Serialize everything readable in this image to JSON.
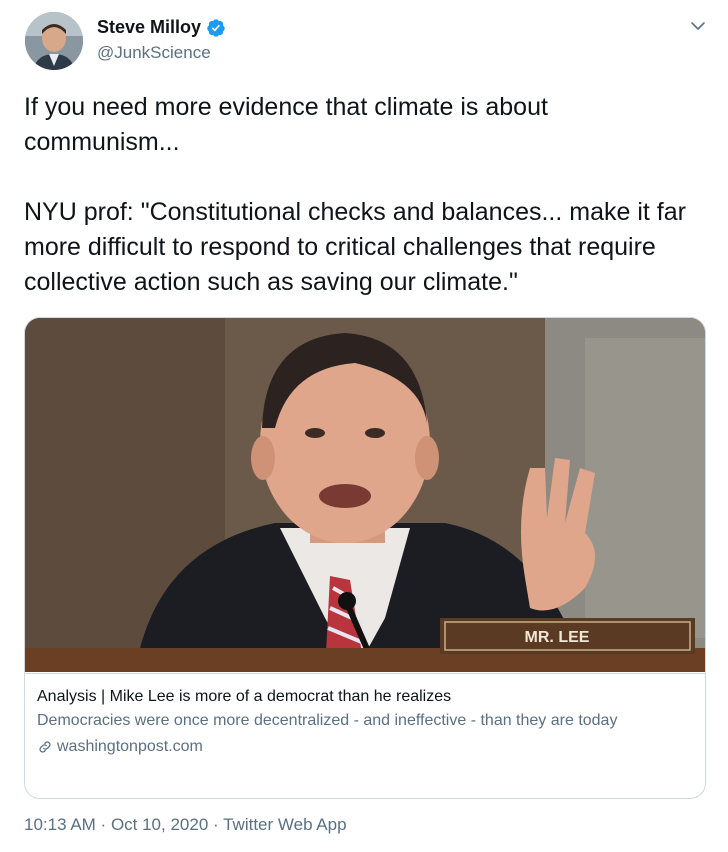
{
  "author": {
    "name": "Steve Milloy",
    "handle": "@JunkScience",
    "verified_icon": "verified-badge-icon"
  },
  "tweet": {
    "text": "If you need more evidence that climate is about communism...\n\nNYU prof: \"Constitutional checks and balances... make it far more difficult to respond to critical challenges that require collective action such as saving our climate.\""
  },
  "card": {
    "nameplate": "MR. LEE",
    "title": "Analysis | Mike Lee is more of a democrat than he realizes",
    "description": "Democracies were once more decentralized - and ineffective - than they are today",
    "domain": "washingtonpost.com",
    "link_icon": "link-icon"
  },
  "footer": {
    "time": "10:13 AM",
    "separator": " · ",
    "date": "Oct 10, 2020",
    "app": "Twitter Web App"
  },
  "colors": {
    "text_primary": "#0f1419",
    "text_secondary": "#5b7083",
    "verified_blue": "#1d9bf0",
    "border": "#cfd9de"
  }
}
